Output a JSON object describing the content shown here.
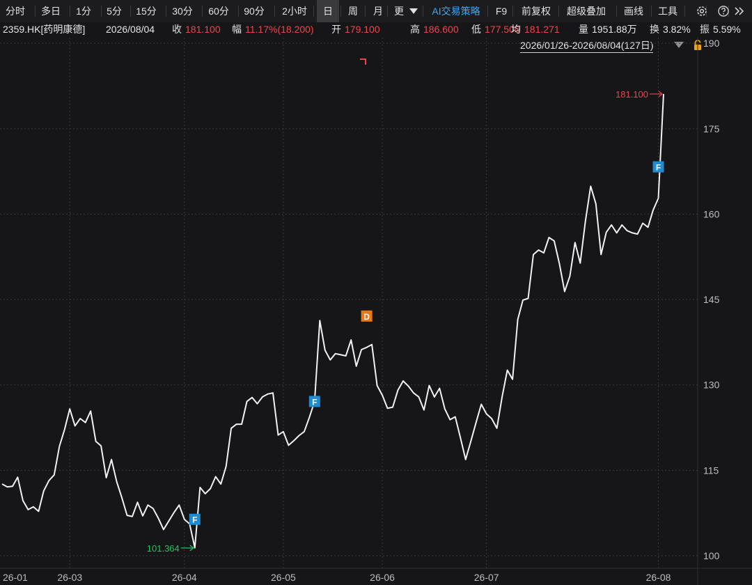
{
  "toolbar": {
    "items": [
      "分时",
      "多日",
      "1分",
      "5分",
      "15分",
      "30分",
      "60分",
      "90分",
      "2小时",
      "日",
      "周",
      "月",
      "更",
      "AI交易策略",
      "F9",
      "前复权",
      "超级叠加",
      "画线",
      "工具"
    ],
    "active": "日",
    "ai_color": "#3fa9f5"
  },
  "quote": {
    "symbol": "2359.HK[药明康德]",
    "date": "2026/08/04",
    "close_label": "收",
    "close": "181.100",
    "amp_label": "幅",
    "amp": "11.17%(18.200)",
    "open_label": "开",
    "open": "179.100",
    "high_label": "高",
    "high": "186.600",
    "low_label": "低",
    "low": "177.500",
    "avg_label": "均",
    "avg": "181.271",
    "vol_label": "量",
    "vol": "1951.88万",
    "turn_label": "换",
    "turn": "3.82%",
    "swing_label": "振",
    "swing": "5.59%"
  },
  "range": {
    "label": "2026/01/26-2026/08/04(127日)"
  },
  "colors": {
    "line": "#f2f2f2",
    "up": "#f0444c",
    "down": "#22c55e",
    "grid": "#3a3a3c",
    "marker_f": "#1f8bd1",
    "marker_d": "#e8791a"
  },
  "chart_data": {
    "type": "line",
    "y_ticks": [
      100,
      115,
      130,
      145,
      160,
      175,
      190
    ],
    "x_ticks": [
      "26-01",
      "26-03",
      "26-04",
      "26-05",
      "26-06",
      "26-07",
      "26-08"
    ],
    "ylim": [
      97.8,
      191
    ],
    "grid": true,
    "series": [
      {
        "values": [
          112.6,
          112.1,
          112.2,
          113.8,
          109.7,
          108.1,
          108.6,
          107.8,
          111.4,
          113.2,
          114.2,
          119.2,
          122.2,
          125.8,
          122.8,
          124.1,
          123.4,
          125.4,
          120.1,
          119.3,
          113.7,
          116.9,
          113.0,
          110.2,
          107.1,
          106.9,
          109.4,
          107.0,
          108.9,
          108.3,
          106.6,
          104.6,
          106.1,
          107.6,
          108.9,
          106.4,
          105.6,
          101.4,
          112.0,
          110.9,
          111.8,
          113.9,
          112.6,
          115.7,
          122.4,
          123.1,
          123.1,
          127.1,
          127.8,
          126.7,
          127.9,
          128.4,
          128.6,
          121.2,
          121.8,
          119.4,
          120.2,
          121.1,
          121.8,
          124.3,
          127.1,
          141.3,
          136.1,
          134.4,
          135.5,
          135.3,
          135.1,
          137.9,
          133.3,
          136.2,
          136.6,
          137.1,
          129.9,
          128.2,
          125.9,
          126.1,
          129.1,
          130.7,
          129.8,
          128.6,
          127.9,
          125.6,
          129.9,
          127.9,
          129.4,
          125.8,
          123.9,
          124.4,
          120.7,
          116.9,
          120.1,
          123.4,
          126.6,
          124.9,
          124.1,
          122.4,
          127.9,
          132.6,
          131.0,
          141.5,
          144.9,
          145.2,
          152.9,
          153.7,
          153.2,
          155.9,
          155.3,
          151.3,
          146.4,
          149.1,
          155.0,
          151.4,
          158.8,
          164.9,
          161.8,
          152.9,
          156.8,
          158.1,
          156.7,
          158.1,
          157.1,
          156.7,
          156.5,
          158.4,
          157.7,
          160.7,
          162.8,
          181.1
        ]
      }
    ],
    "annotations": {
      "last": {
        "value": "181.100",
        "index": 127
      },
      "min": {
        "value": "101.364",
        "index": 37
      }
    },
    "markers": [
      {
        "label": "F",
        "index": 37,
        "value": 106.4
      },
      {
        "label": "F",
        "index": 60,
        "value": 127.1
      },
      {
        "label": "D",
        "index": 70,
        "value": 142.1
      },
      {
        "label": "F",
        "index": 126,
        "value": 168.3
      }
    ]
  }
}
